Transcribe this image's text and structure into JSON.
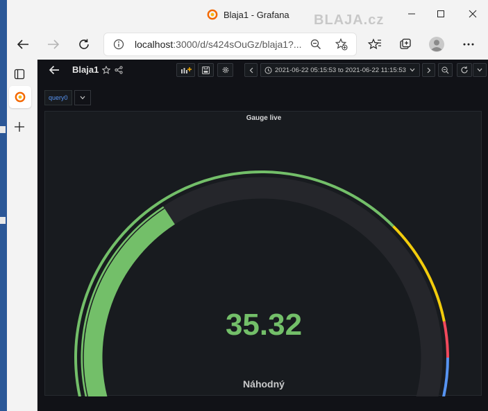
{
  "browser": {
    "window_title": "Blaja1 - Grafana",
    "watermark": "BLAJA.cz",
    "address_url_host": "localhost",
    "address_url_rest": ":3000/d/s424sOuGz/blaja1?..."
  },
  "grafana": {
    "dashboard_title": "Blaja1",
    "time_range": "2021-06-22 05:15:53 to 2021-06-22 11:15:53",
    "variable_label": "query0",
    "panel": {
      "title": "Gauge live",
      "value": "35.32",
      "value_numeric": 35.32,
      "min": 0,
      "max": 100,
      "label": "Náhodný",
      "thresholds": [
        {
          "from": 0,
          "to": 70,
          "color": "#73bf69"
        },
        {
          "from": 70,
          "to": 85,
          "color": "#f2cc0c"
        },
        {
          "from": 85,
          "to": 90,
          "color": "#f2495c"
        },
        {
          "from": 90,
          "to": 100,
          "color": "#5794f2"
        }
      ],
      "value_color": "#73bf69",
      "track_color": "#25262b"
    }
  },
  "icons": [
    "back-arrow-icon",
    "forward-arrow-icon",
    "refresh-icon",
    "info-icon",
    "zoom-out-icon",
    "add-favorite-icon",
    "favorites-icon",
    "collections-icon",
    "profile-icon",
    "more-icon",
    "tab-actions-icon",
    "grafana-logo-icon",
    "new-tab-icon",
    "star-icon",
    "share-icon",
    "add-panel-icon",
    "save-icon",
    "settings-icon",
    "clock-icon",
    "zoom-icon",
    "refresh-icon",
    "chevron-down-icon"
  ]
}
